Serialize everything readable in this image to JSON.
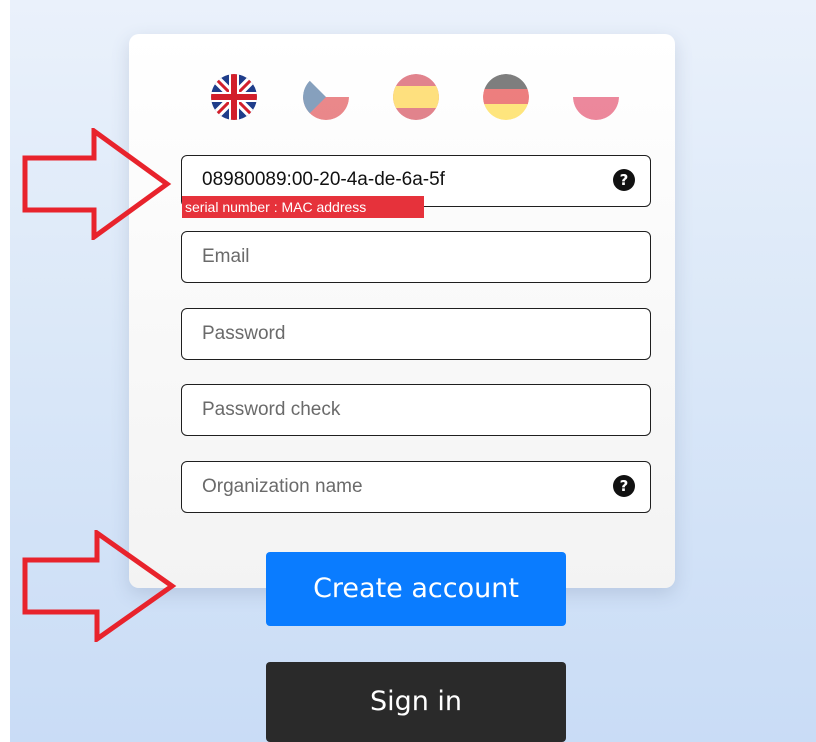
{
  "languages": [
    {
      "code": "en",
      "icon": "uk-flag-icon",
      "active": true
    },
    {
      "code": "cs",
      "icon": "czech-flag-icon",
      "active": false
    },
    {
      "code": "es",
      "icon": "spain-flag-icon",
      "active": false
    },
    {
      "code": "de",
      "icon": "germany-flag-icon",
      "active": false
    },
    {
      "code": "pl",
      "icon": "poland-flag-icon",
      "active": false
    }
  ],
  "form": {
    "serial": {
      "value": "08980089:00-20-4a-de-6a-5f",
      "hint": "serial number : MAC address",
      "help_glyph": "?"
    },
    "email": {
      "placeholder": "Email",
      "value": ""
    },
    "password": {
      "placeholder": "Password",
      "value": ""
    },
    "password_check": {
      "placeholder": "Password check",
      "value": ""
    },
    "organization": {
      "placeholder": "Organization name",
      "value": "",
      "help_glyph": "?"
    }
  },
  "buttons": {
    "create_account": "Create account",
    "sign_in": "Sign in"
  },
  "annotations": {
    "arrow_icon": "right-arrow-outline",
    "arrow_color": "#e8232c"
  },
  "colors": {
    "primary": "#0a7cff",
    "dark": "#2a2a2a",
    "hint_badge": "#e6323b"
  }
}
